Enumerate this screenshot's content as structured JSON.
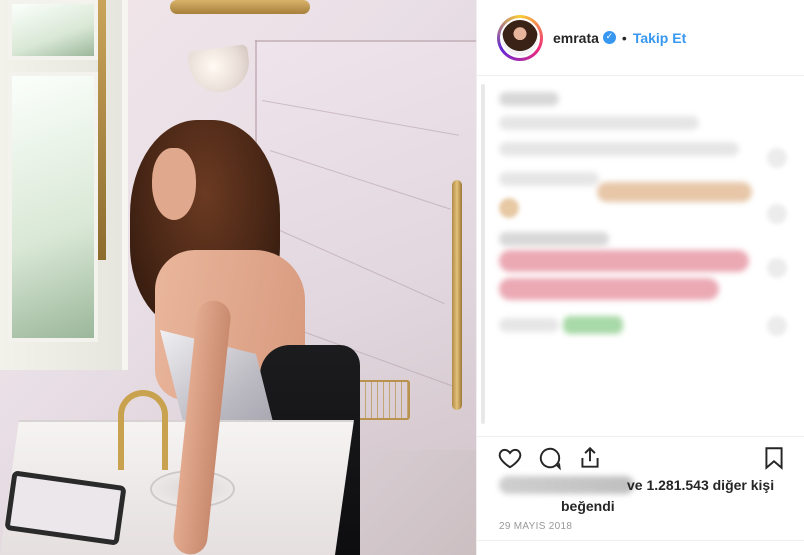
{
  "post": {
    "username": "emrata",
    "verified": true,
    "separator": "•",
    "follow_label": "Takip Et"
  },
  "likes": {
    "text": "ve 1.281.543 diğer kişi",
    "text_line2": "beğendi"
  },
  "date": "29 MAYIS 2018",
  "icons": {
    "like": "heart-icon",
    "comment": "comment-icon",
    "share": "share-icon",
    "save": "bookmark-icon",
    "verified": "verified-badge-icon"
  },
  "colors": {
    "link": "#3897f0",
    "text": "#262626",
    "muted": "#999999",
    "border": "#efefef"
  }
}
